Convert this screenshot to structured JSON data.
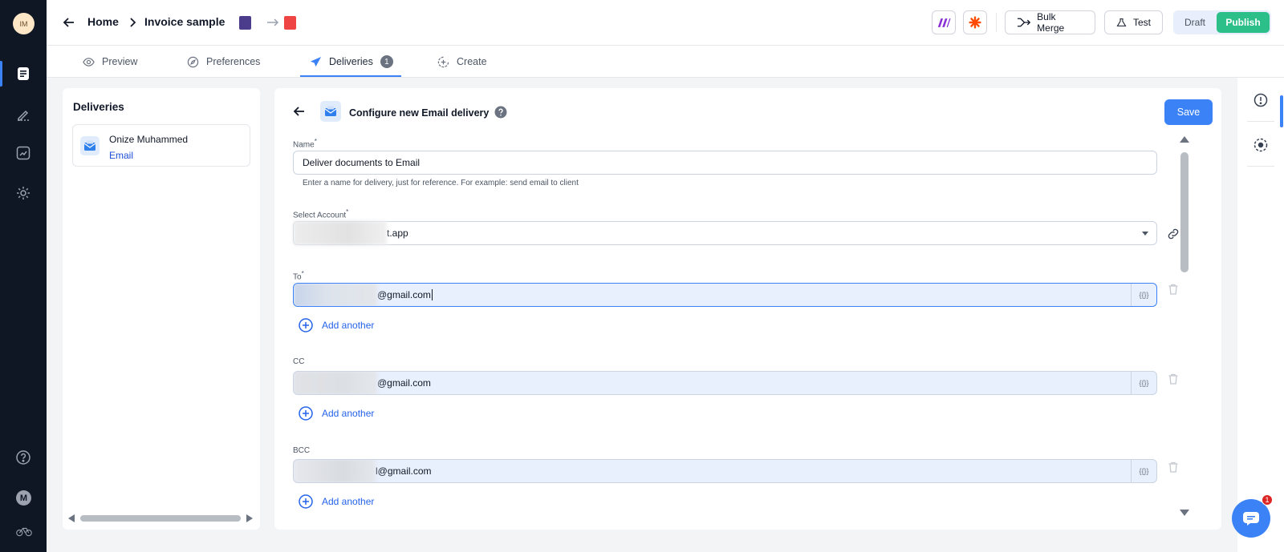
{
  "user": {
    "initials": "IM",
    "short": "M"
  },
  "header": {
    "breadcrumb": {
      "home": "Home",
      "current": "Invoice sample"
    },
    "bulk_merge_label": "Bulk Merge",
    "test_label": "Test",
    "draft_label": "Draft",
    "publish_label": "Publish"
  },
  "tabs": [
    {
      "label": "Preview",
      "icon": "eye-icon"
    },
    {
      "label": "Preferences",
      "icon": "compass-icon"
    },
    {
      "label": "Deliveries",
      "icon": "send-icon",
      "badge": "1",
      "active": true
    },
    {
      "label": "Create",
      "icon": "plus-circle-icon"
    }
  ],
  "deliveries": {
    "title": "Deliveries",
    "items": [
      {
        "name": "Onize Muhammed",
        "type": "Email"
      }
    ]
  },
  "config": {
    "title": "Configure new Email delivery",
    "save_label": "Save",
    "name_label": "Name",
    "name_value": "Deliver documents to Email",
    "name_helper": "Enter a name for delivery, just for reference. For example: send email to client",
    "account_label": "Select Account",
    "account_value": "t.app",
    "to_label": "To",
    "to_value": "@gmail.com",
    "cc_label": "CC",
    "cc_value": "@gmail.com",
    "bcc_label": "BCC",
    "bcc_value": "l@gmail.com",
    "variable_chip": "{{}}",
    "add_another_label": "Add another",
    "required_mark": "*"
  },
  "chat": {
    "badge": "1"
  },
  "colors": {
    "accent": "#3b82f6",
    "publish": "#2dbf8a",
    "rail": "#0f1724"
  }
}
